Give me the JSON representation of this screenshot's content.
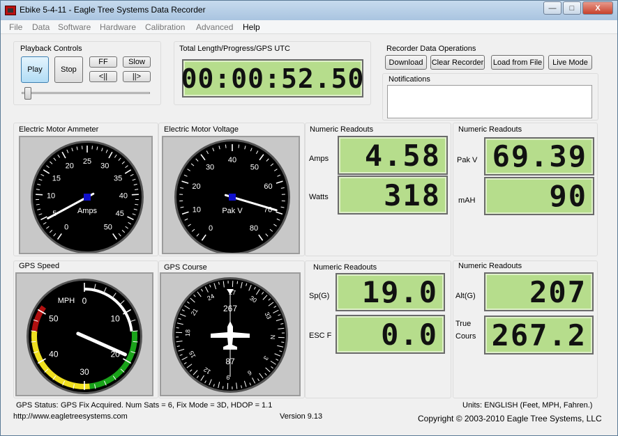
{
  "window": {
    "title": "Ebike 5-4-11 - Eagle Tree Systems Data Recorder"
  },
  "titlebar_buttons": {
    "minimize": "—",
    "maximize": "□",
    "close": "X"
  },
  "menu": [
    "File",
    "Data",
    "Software",
    "Hardware",
    "Calibration",
    "Advanced",
    "Help"
  ],
  "playback": {
    "title": "Playback Controls",
    "play": "Play",
    "stop": "Stop",
    "ff": "FF",
    "slow": "Slow",
    "step_back": "<||",
    "step_fwd": "||>"
  },
  "progress": {
    "title": "Total Length/Progress/GPS UTC",
    "time": "00:00:52.50"
  },
  "recorder": {
    "title": "Recorder Data Operations",
    "download": "Download",
    "clear": "Clear Recorder",
    "load": "Load from File",
    "live": "Live Mode",
    "notifications_title": "Notifications"
  },
  "ammeter": {
    "title": "Electric Motor Ammeter",
    "unit": "Amps",
    "ticks": [
      "0",
      "5",
      "10",
      "15",
      "20",
      "25",
      "30",
      "35",
      "40",
      "45",
      "50"
    ],
    "value": 4.58
  },
  "voltage": {
    "title": "Electric Motor Voltage",
    "unit": "Pak V",
    "ticks": [
      "0",
      "10",
      "20",
      "30",
      "40",
      "50",
      "60",
      "70",
      "80"
    ],
    "value": 69.39
  },
  "readouts1": {
    "title": "Numeric Readouts",
    "label1": "Amps",
    "value1": "4.58",
    "label2": "Watts",
    "value2": "318"
  },
  "readouts2": {
    "title": "Numeric Readouts",
    "label1": "Pak V",
    "value1": "69.39",
    "label2": "mAH",
    "value2": "90"
  },
  "gps_speed": {
    "title": "GPS Speed",
    "unit": "MPH",
    "ticks": [
      "0",
      "10",
      "20",
      "30",
      "40",
      "50"
    ],
    "value": 19.0
  },
  "gps_course": {
    "title": "GPS Course",
    "heading_top": "267",
    "heading_bottom": "87",
    "ticks": [
      "24",
      "27",
      "30",
      "33",
      "N",
      "3",
      "6",
      "9",
      "12",
      "15",
      "18",
      "21"
    ],
    "value": 267.2
  },
  "readouts3": {
    "title": "Numeric Readouts",
    "label1": "Sp(G)",
    "value1": "19.0",
    "label2": "ESC F",
    "value2": "0.0"
  },
  "readouts4": {
    "title": "Numeric Readouts",
    "label1": "Alt(G)",
    "value1": "207",
    "label2a": "True",
    "label2b": "Cours",
    "value2": "267.2"
  },
  "status": {
    "gps_label": "GPS Status:",
    "gps_text": "GPS Fix Acquired.  Num Sats = 6, Fix Mode = 3D, HDOP = 1.1",
    "url": "http://www.eagletreesystems.com",
    "version": "Version 9.13",
    "units": "Units: ENGLISH (Feet, MPH, Fahren.)",
    "copyright": "Copyright © 2003-2010 Eagle Tree Systems, LLC"
  },
  "colors": {
    "lcd": "#b6dd8c",
    "gauge_face": "#000000",
    "needle_hub": "#1010cc",
    "arc_white": "#ffffff",
    "arc_green": "#1aa31a",
    "arc_yellow": "#f0e020",
    "arc_red": "#b01010"
  }
}
